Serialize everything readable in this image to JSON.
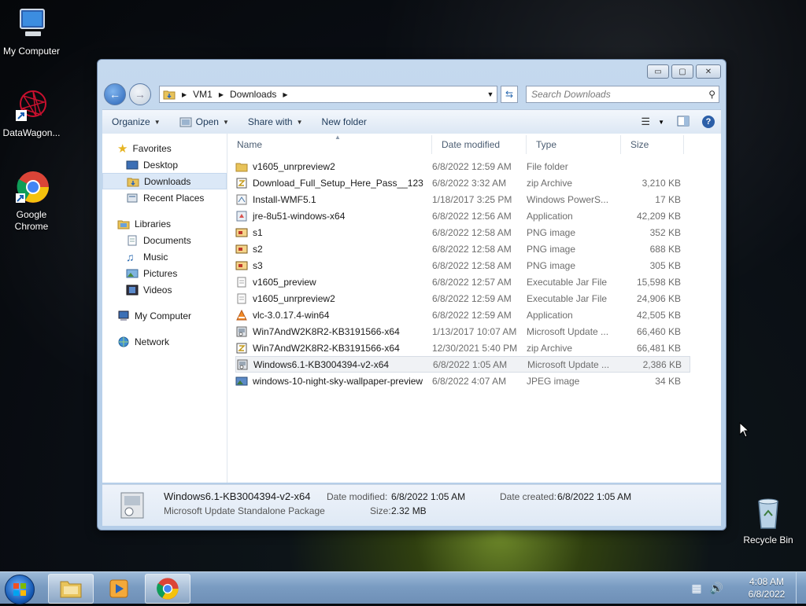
{
  "desktop": {
    "icons": [
      {
        "label": "My Computer"
      },
      {
        "label": "DataWagon..."
      },
      {
        "label": "Google Chrome"
      },
      {
        "label": "Recycle Bin"
      }
    ]
  },
  "window": {
    "caption_buttons": {
      "minimize": "▭",
      "maximize": "▢",
      "close": "✕"
    },
    "breadcrumb": [
      "VM1",
      "Downloads"
    ],
    "search_placeholder": "Search Downloads",
    "toolbar": {
      "organize": "Organize",
      "open": "Open",
      "share": "Share with",
      "new_folder": "New folder"
    },
    "nav": {
      "favorites": "Favorites",
      "desktop": "Desktop",
      "downloads": "Downloads",
      "recent": "Recent Places",
      "libraries": "Libraries",
      "documents": "Documents",
      "music": "Music",
      "pictures": "Pictures",
      "videos": "Videos",
      "computer": "My Computer",
      "network": "Network"
    },
    "columns": {
      "name": "Name",
      "date": "Date modified",
      "type": "Type",
      "size": "Size"
    },
    "files": [
      {
        "name": "v1605_unrpreview2",
        "date": "6/8/2022 12:59 AM",
        "type": "File folder",
        "size": "",
        "icon": "folder-icon"
      },
      {
        "name": "Download_Full_Setup_Here_Pass__123",
        "date": "6/8/2022 3:32 AM",
        "type": "zip Archive",
        "size": "3,210 KB",
        "icon": "zip-icon"
      },
      {
        "name": "Install-WMF5.1",
        "date": "1/18/2017 3:25 PM",
        "type": "Windows PowerS...",
        "size": "17 KB",
        "icon": "script-icon"
      },
      {
        "name": "jre-8u51-windows-x64",
        "date": "6/8/2022 12:56 AM",
        "type": "Application",
        "size": "42,209 KB",
        "icon": "app-icon"
      },
      {
        "name": "s1",
        "date": "6/8/2022 12:58 AM",
        "type": "PNG image",
        "size": "352 KB",
        "icon": "image-icon"
      },
      {
        "name": "s2",
        "date": "6/8/2022 12:58 AM",
        "type": "PNG image",
        "size": "688 KB",
        "icon": "image-icon"
      },
      {
        "name": "s3",
        "date": "6/8/2022 12:58 AM",
        "type": "PNG image",
        "size": "305 KB",
        "icon": "image-icon"
      },
      {
        "name": "v1605_preview",
        "date": "6/8/2022 12:57 AM",
        "type": "Executable Jar File",
        "size": "15,598 KB",
        "icon": "jar-icon"
      },
      {
        "name": "v1605_unrpreview2",
        "date": "6/8/2022 12:59 AM",
        "type": "Executable Jar File",
        "size": "24,906 KB",
        "icon": "jar-icon"
      },
      {
        "name": "vlc-3.0.17.4-win64",
        "date": "6/8/2022 12:59 AM",
        "type": "Application",
        "size": "42,505 KB",
        "icon": "vlc-icon"
      },
      {
        "name": "Win7AndW2K8R2-KB3191566-x64",
        "date": "1/13/2017 10:07 AM",
        "type": "Microsoft Update ...",
        "size": "66,460 KB",
        "icon": "msu-icon"
      },
      {
        "name": "Win7AndW2K8R2-KB3191566-x64",
        "date": "12/30/2021 5:40 PM",
        "type": "zip Archive",
        "size": "66,481 KB",
        "icon": "zip-icon"
      },
      {
        "name": "Windows6.1-KB3004394-v2-x64",
        "date": "6/8/2022 1:05 AM",
        "type": "Microsoft Update ...",
        "size": "2,386 KB",
        "icon": "msu-icon",
        "selected": true
      },
      {
        "name": "windows-10-night-sky-wallpaper-preview",
        "date": "6/8/2022 4:07 AM",
        "type": "JPEG image",
        "size": "34 KB",
        "icon": "jpeg-icon"
      }
    ],
    "details": {
      "name": "Windows6.1-KB3004394-v2-x64",
      "type": "Microsoft Update Standalone Package",
      "modified_label": "Date modified:",
      "modified_value": "6/8/2022 1:05 AM",
      "created_label": "Date created:",
      "created_value": "6/8/2022 1:05 AM",
      "size_label": "Size:",
      "size_value": "2.32 MB"
    }
  },
  "taskbar": {
    "time": "4:08 AM",
    "date": "6/8/2022"
  },
  "colors": {
    "selection": "#dbe8f7",
    "accent": "#2a64b7"
  }
}
